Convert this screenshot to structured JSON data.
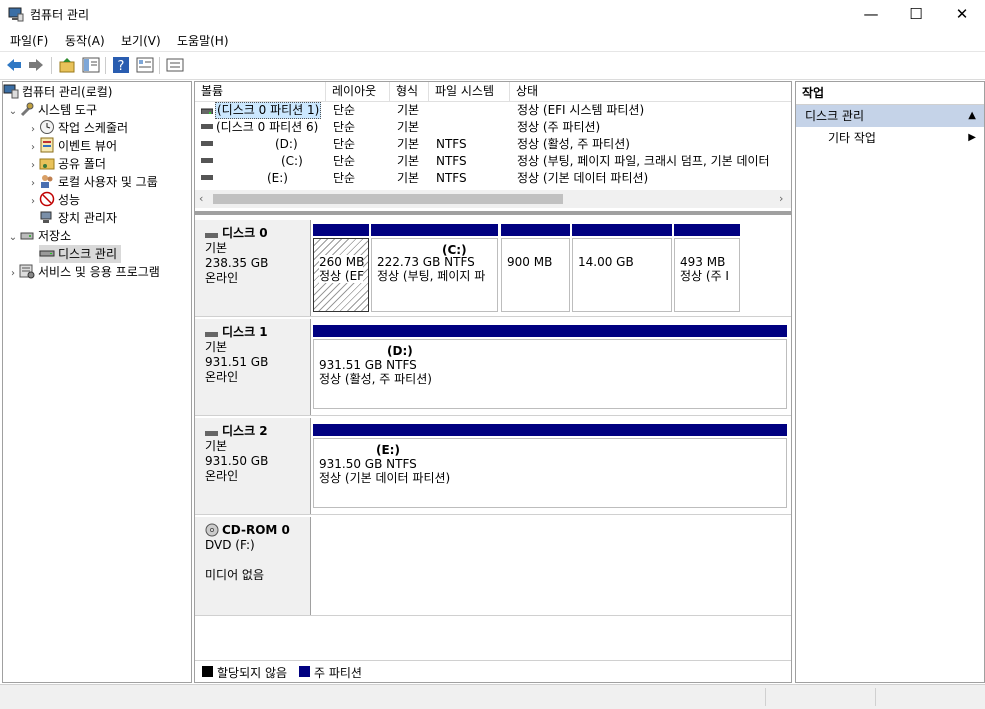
{
  "window": {
    "title": "컴퓨터 관리",
    "min": "—",
    "max": "☐",
    "close": "✕"
  },
  "menu": [
    "파일(F)",
    "동작(A)",
    "보기(V)",
    "도움말(H)"
  ],
  "tree": {
    "root": "컴퓨터 관리(로컬)",
    "system_tools": "시스템 도구",
    "task_scheduler": "작업 스케줄러",
    "event_viewer": "이벤트 뷰어",
    "shared_folders": "공유 폴더",
    "local_users": "로컬 사용자 및 그룹",
    "performance": "성능",
    "device_manager": "장치 관리자",
    "storage": "저장소",
    "disk_management": "디스크 관리",
    "services": "서비스 및 응용 프로그램"
  },
  "volume_table": {
    "headers": [
      "볼륨",
      "레이아웃",
      "형식",
      "파일 시스템",
      "상태"
    ],
    "rows": [
      {
        "volume": "(디스크 0 파티션 1)",
        "layout": "단순",
        "type": "기본",
        "fs": "",
        "status": "정상 (EFI 시스템 파티션)"
      },
      {
        "volume": "(디스크 0 파티션 6)",
        "layout": "단순",
        "type": "기본",
        "fs": "",
        "status": "정상 (주 파티션)"
      },
      {
        "volume": "(D:)",
        "layout": "단순",
        "type": "기본",
        "fs": "NTFS",
        "status": "정상 (활성, 주 파티션)"
      },
      {
        "volume": "(C:)",
        "layout": "단순",
        "type": "기본",
        "fs": "NTFS",
        "status": "정상 (부팅, 페이지 파일, 크래시 덤프, 기본 데이터"
      },
      {
        "volume": "(E:)",
        "layout": "단순",
        "type": "기본",
        "fs": "NTFS",
        "status": "정상 (기본 데이터 파티션)"
      }
    ]
  },
  "disks": {
    "d0": {
      "name": "디스크 0",
      "type": "기본",
      "size": "238.35 GB",
      "state": "온라인",
      "parts": [
        {
          "title": "",
          "size": "260 MB",
          "status": "정상 (EF"
        },
        {
          "title": "(C:)",
          "size": "222.73 GB NTFS",
          "status": "정상 (부팅, 페이지 파"
        },
        {
          "title": "",
          "size": "900 MB",
          "status": ""
        },
        {
          "title": "",
          "size": "14.00 GB",
          "status": ""
        },
        {
          "title": "",
          "size": "493 MB",
          "status": "정상 (주 I"
        }
      ]
    },
    "d1": {
      "name": "디스크 1",
      "type": "기본",
      "size": "931.51 GB",
      "state": "온라인",
      "part": {
        "title": "(D:)",
        "size": "931.51 GB NTFS",
        "status": "정상 (활성, 주 파티션)"
      }
    },
    "d2": {
      "name": "디스크 2",
      "type": "기본",
      "size": "931.50 GB",
      "state": "온라인",
      "part": {
        "title": "(E:)",
        "size": "931.50 GB NTFS",
        "status": "정상 (기본 데이터 파티션)"
      }
    },
    "cd": {
      "name": "CD-ROM 0",
      "type": "DVD (F:)",
      "state": "미디어 없음"
    }
  },
  "legend": {
    "unallocated": "할당되지 않음",
    "primary": "주 파티션"
  },
  "actions": {
    "header": "작업",
    "section": "디스크 관리",
    "more": "기타 작업"
  },
  "colors": {
    "primary_partition": "#000080",
    "selection": "#cce8ff",
    "section_bg": "#c5d3e8"
  }
}
